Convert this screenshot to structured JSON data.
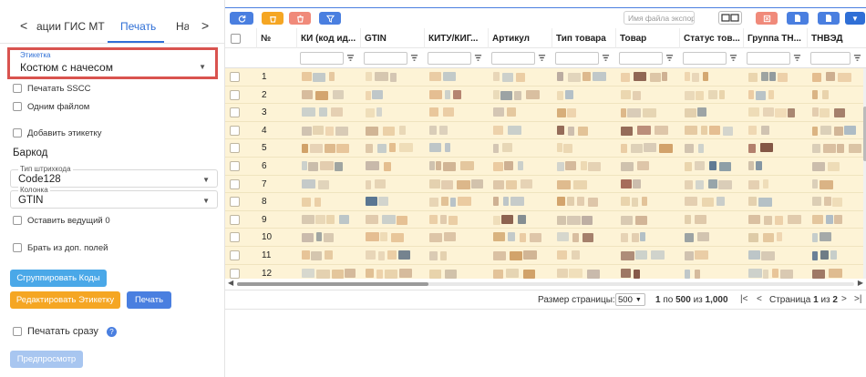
{
  "left_panel": {
    "tabs": {
      "prev_arrow": "<",
      "next_arrow": ">",
      "items": [
        "ации ГИС МТ",
        "Печать",
        "На"
      ],
      "active_index": 1
    },
    "label_field": {
      "label": "Этикетка",
      "value": "Костюм с начесом"
    },
    "checkboxes_top": [
      {
        "label": "Печатать SSCC",
        "checked": false
      },
      {
        "label": "Одним файлом",
        "checked": false
      },
      {
        "label": "Добавить этикетку",
        "checked": false
      }
    ],
    "barcode": {
      "title": "Баркод",
      "type_field": {
        "label": "Тип штрихкода",
        "value": "Code128"
      },
      "column_field": {
        "label": "Колонка",
        "value": "GTIN"
      },
      "checkboxes": [
        {
          "label": "Оставить ведущий 0",
          "checked": false
        },
        {
          "label": "Брать из доп. полей",
          "checked": false
        }
      ]
    },
    "buttons": {
      "group_codes": "Сгруппировать Коды",
      "edit_label": "Редактировать Этикетку",
      "print": "Печать",
      "preview": "Предпросмотр"
    },
    "print_now": {
      "label": "Печатать сразу",
      "checked": false
    },
    "help_glyph": "?"
  },
  "toolbar": {
    "export_placeholder": "Имя файла экспорта"
  },
  "grid": {
    "columns": [
      "№",
      "КИ (код ид...",
      "GTIN",
      "КИТУ/КИГ...",
      "Артикул",
      "Тип товара",
      "Товар",
      "Статус тов...",
      "Группа ТН...",
      "ТНВЭД"
    ],
    "row_numbers": [
      "1",
      "2",
      "3",
      "4",
      "5",
      "6",
      "7",
      "8",
      "9",
      "10",
      "11",
      "12"
    ],
    "row_background": "#fdf3d6"
  },
  "pagination": {
    "page_size_label": "Размер страницы:",
    "page_size_value": "500",
    "range_from": "1",
    "range_to_label": "по",
    "range_to": "500",
    "of_label": "из",
    "total": "1,000",
    "page_label": "Страница",
    "page_current": "1",
    "page_of_label": "из",
    "page_total": "2"
  },
  "colors": {
    "accent": "#2f6fd6",
    "highlight_border": "#d9534f",
    "orange": "#f5a623",
    "light_blue": "#4aa8e8"
  }
}
